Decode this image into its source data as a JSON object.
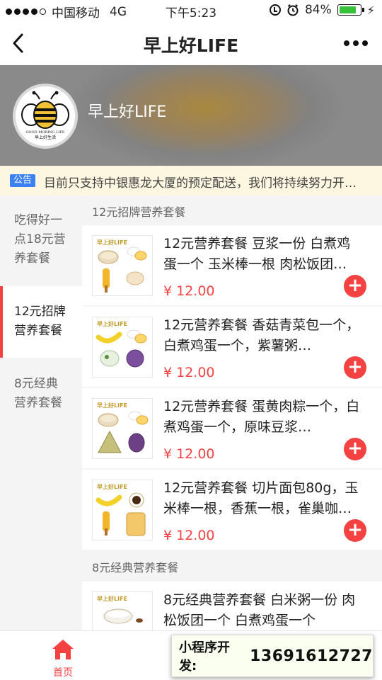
{
  "status_bar": {
    "carrier": "中国移动",
    "network": "4G",
    "time": "下午5:23",
    "battery": "84%",
    "battery_level": 0.84,
    "battery_color": "#38c13b"
  },
  "nav": {
    "title": "早上好LIFE",
    "back_icon": "chevron-left-icon",
    "more_icon": "more-dots-icon"
  },
  "store": {
    "name": "早上好LIFE",
    "logo": {
      "line1": "GOOD MORING LIFE",
      "line2": "早上好生活"
    }
  },
  "notice": {
    "tag": "公告",
    "text": "目前只支持中银惠龙大厦的预定配送，我们将持续努力开…"
  },
  "sidebar": {
    "items": [
      {
        "label": "吃得好一点18元营养套餐",
        "active": false
      },
      {
        "label": "12元招牌营养套餐",
        "active": true
      },
      {
        "label": "8元经典营养套餐",
        "active": false
      }
    ]
  },
  "sections": [
    {
      "title": "12元招牌营养套餐",
      "products": [
        {
          "title": "12元营养套餐 豆浆一份 白煮鸡蛋一个 玉米棒一根 肉松饭团…",
          "price": "¥ 12.00",
          "thumb_brand": "早上好LIFE"
        },
        {
          "title": "12元营养套餐 香菇青菜包一个，白煮鸡蛋一个，紫薯粥…",
          "price": "¥ 12.00",
          "thumb_brand": "早上好LIFE"
        },
        {
          "title": "12元营养套餐 蛋黄肉粽一个，白煮鸡蛋一个，原味豆浆…",
          "price": "¥ 12.00",
          "thumb_brand": "早上好LIFE"
        },
        {
          "title": "12元营养套餐 切片面包80g，玉米棒一根，香蕉一根，雀巢咖…",
          "price": "¥ 12.00",
          "thumb_brand": "早上好LIFE"
        }
      ]
    },
    {
      "title": "8元经典营养套餐",
      "products": [
        {
          "title": "8元经典营养套餐 白米粥一份 肉松饭团一个 白煮鸡蛋一个",
          "price": "",
          "thumb_brand": "早上好LIFE"
        }
      ]
    }
  ],
  "add_button": {
    "label": "+",
    "color": "#f44242"
  },
  "tab_bar": {
    "home_label": "首页",
    "home_icon": "home-icon",
    "active_color": "#f44242"
  },
  "contact": {
    "label": "小程序开发:",
    "phone": "13691612727"
  }
}
